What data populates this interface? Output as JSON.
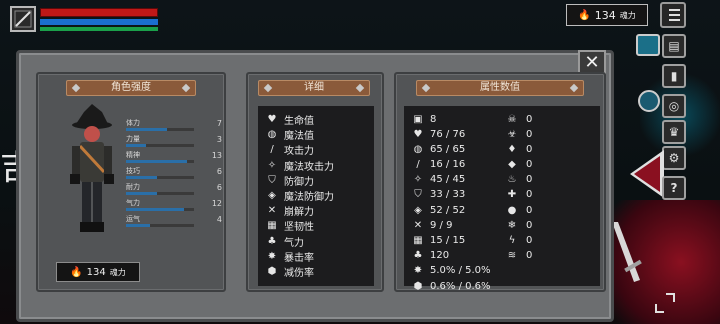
{
  "hud": {
    "soul_value": "134",
    "soul_unit": "魂力"
  },
  "left_panel": {
    "title": "角色强度",
    "stats": [
      {
        "label": "体力",
        "value": "7",
        "fill": 0.6
      },
      {
        "label": "力量",
        "value": "3",
        "fill": 0.3
      },
      {
        "label": "精神",
        "value": "13",
        "fill": 0.9
      },
      {
        "label": "技巧",
        "value": "6",
        "fill": 0.45
      },
      {
        "label": "耐力",
        "value": "6",
        "fill": 0.45
      },
      {
        "label": "气力",
        "value": "12",
        "fill": 0.85
      },
      {
        "label": "运气",
        "value": "4",
        "fill": 0.35
      }
    ],
    "soul_value": "134",
    "soul_unit": "魂力"
  },
  "middle_panel": {
    "title": "详细",
    "rows": [
      {
        "icon": "heart-icon",
        "label": "生命值"
      },
      {
        "icon": "brain-icon",
        "label": "魔法值"
      },
      {
        "icon": "sword-icon",
        "label": "攻击力"
      },
      {
        "icon": "magic-attack-icon",
        "label": "魔法攻击力"
      },
      {
        "icon": "shield-icon",
        "label": "防御力"
      },
      {
        "icon": "magic-defense-icon",
        "label": "魔法防御力"
      },
      {
        "icon": "break-icon",
        "label": "崩解力"
      },
      {
        "icon": "tenacity-icon",
        "label": "坚韧性"
      },
      {
        "icon": "lungs-icon",
        "label": "气力"
      },
      {
        "icon": "crit-icon",
        "label": "暴击率"
      },
      {
        "icon": "damage-reduction-icon",
        "label": "减伤率"
      }
    ]
  },
  "right_panel": {
    "title": "属性数值",
    "rows": [
      {
        "value": "8",
        "icon2": "skull-icon",
        "value2": "0"
      },
      {
        "value": "76 / 76",
        "icon2": "poison-icon",
        "value2": "0"
      },
      {
        "value": "65 / 65",
        "icon2": "blood-icon",
        "value2": "0"
      },
      {
        "value": "16 / 16",
        "icon2": "water-icon",
        "value2": "0"
      },
      {
        "value": "45 / 45",
        "icon2": "fire-icon",
        "value2": "0"
      },
      {
        "value": "33 / 33",
        "icon2": "holy-icon",
        "value2": "0"
      },
      {
        "value": "52 / 52",
        "icon2": "dark-icon",
        "value2": "0"
      },
      {
        "value": "9 / 9",
        "icon2": "frost-icon",
        "value2": "0"
      },
      {
        "value": "15 / 15",
        "icon2": "lightning-icon",
        "value2": "0"
      },
      {
        "value": "120",
        "icon2": "wind-icon",
        "value2": "0"
      },
      {
        "value": "5.0% / 5.0%",
        "icon2": "",
        "value2": ""
      },
      {
        "value": "0.6% / 0.6%",
        "icon2": "",
        "value2": ""
      }
    ]
  },
  "colors": {
    "hp": "#c01818",
    "mp": "#1a6fd0",
    "xp": "#1aa04a",
    "title_tab": "#8a5a3a",
    "stat_fill": "#2a6fa8"
  },
  "background": {
    "text": "吉"
  }
}
